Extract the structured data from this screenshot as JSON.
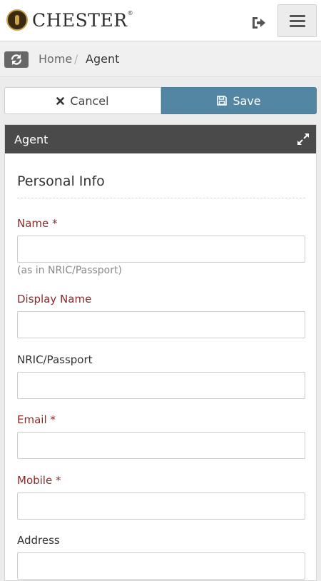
{
  "header": {
    "brand": "CHESTER",
    "brand_mark": "®",
    "logout_icon": "sign-out-icon",
    "menu_icon": "hamburger-icon"
  },
  "breadcrumb": {
    "refresh_icon": "refresh-icon",
    "home": "Home",
    "separator": "/",
    "current": "Agent"
  },
  "actions": {
    "cancel_label": "Cancel",
    "cancel_icon": "close-icon",
    "save_label": "Save",
    "save_icon": "save-icon",
    "save_color": "#5286a3"
  },
  "panel": {
    "title": "Agent",
    "expand_icon": "expand-icon",
    "section_title": "Personal Info"
  },
  "form": {
    "name_label": "Name *",
    "name_value": "",
    "name_hint": "(as in NRIC/Passport)",
    "display_name_label": "Display Name",
    "display_name_value": "",
    "nric_label": "NRIC/Passport",
    "nric_value": "",
    "email_label": "Email *",
    "email_value": "",
    "mobile_label": "Mobile *",
    "mobile_value": "",
    "address_label": "Address",
    "address_value": ""
  },
  "colors": {
    "required_label": "#8b2a2a",
    "panel_header": "#4a4a4a"
  }
}
